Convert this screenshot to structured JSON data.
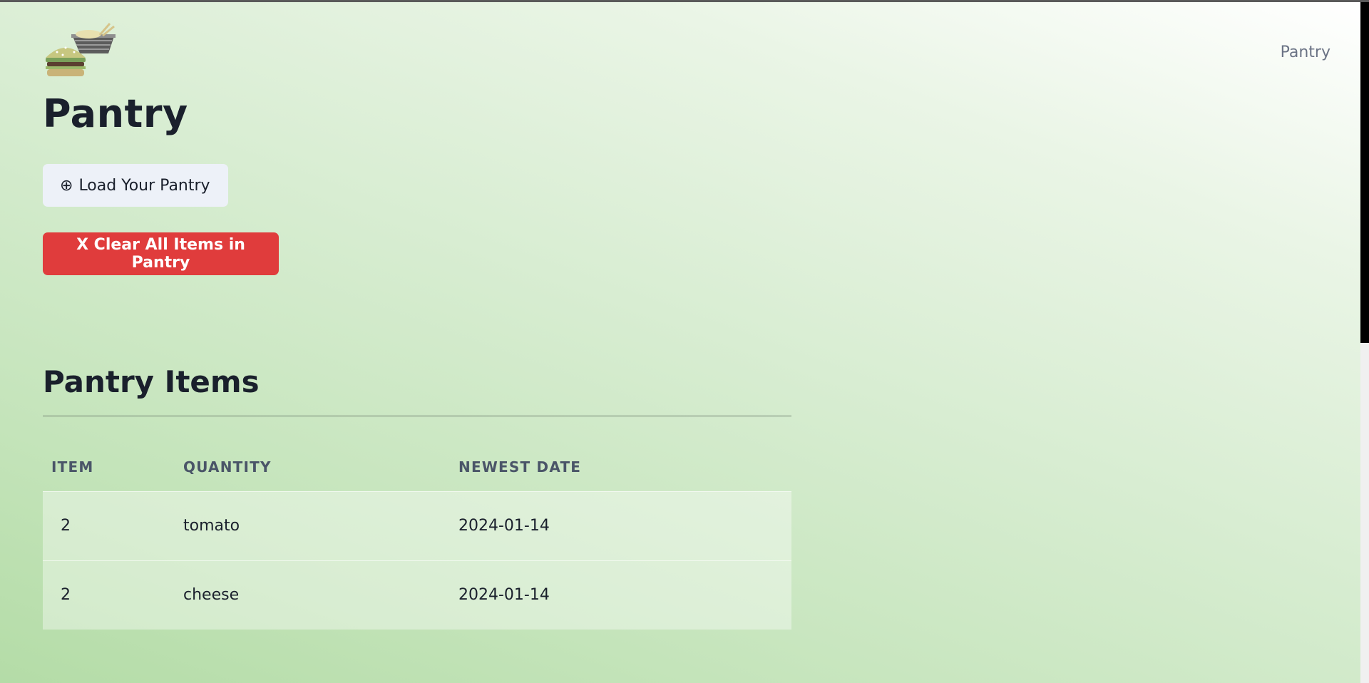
{
  "header": {
    "logo_icon": "burger-and-noodle-bowl-logo",
    "nav_link": "Pantry"
  },
  "main": {
    "title": "Pantry",
    "load_button": {
      "icon": "circled-plus",
      "glyph": "⊕",
      "label": "Load Your Pantry"
    },
    "clear_button": {
      "label": "X Clear All Items in Pantry"
    },
    "section_title": "Pantry Items",
    "table": {
      "headers": [
        "ITEM",
        "QUANTITY",
        "NEWEST DATE"
      ],
      "rows": [
        [
          "2",
          "tomato",
          "2024-01-14"
        ],
        [
          "2",
          "cheese",
          "2024-01-14"
        ]
      ]
    }
  },
  "colors": {
    "danger": "#e03c3c",
    "secondary_button": "#edf1f8",
    "text": "#1a202c",
    "muted": "#6b7385"
  }
}
